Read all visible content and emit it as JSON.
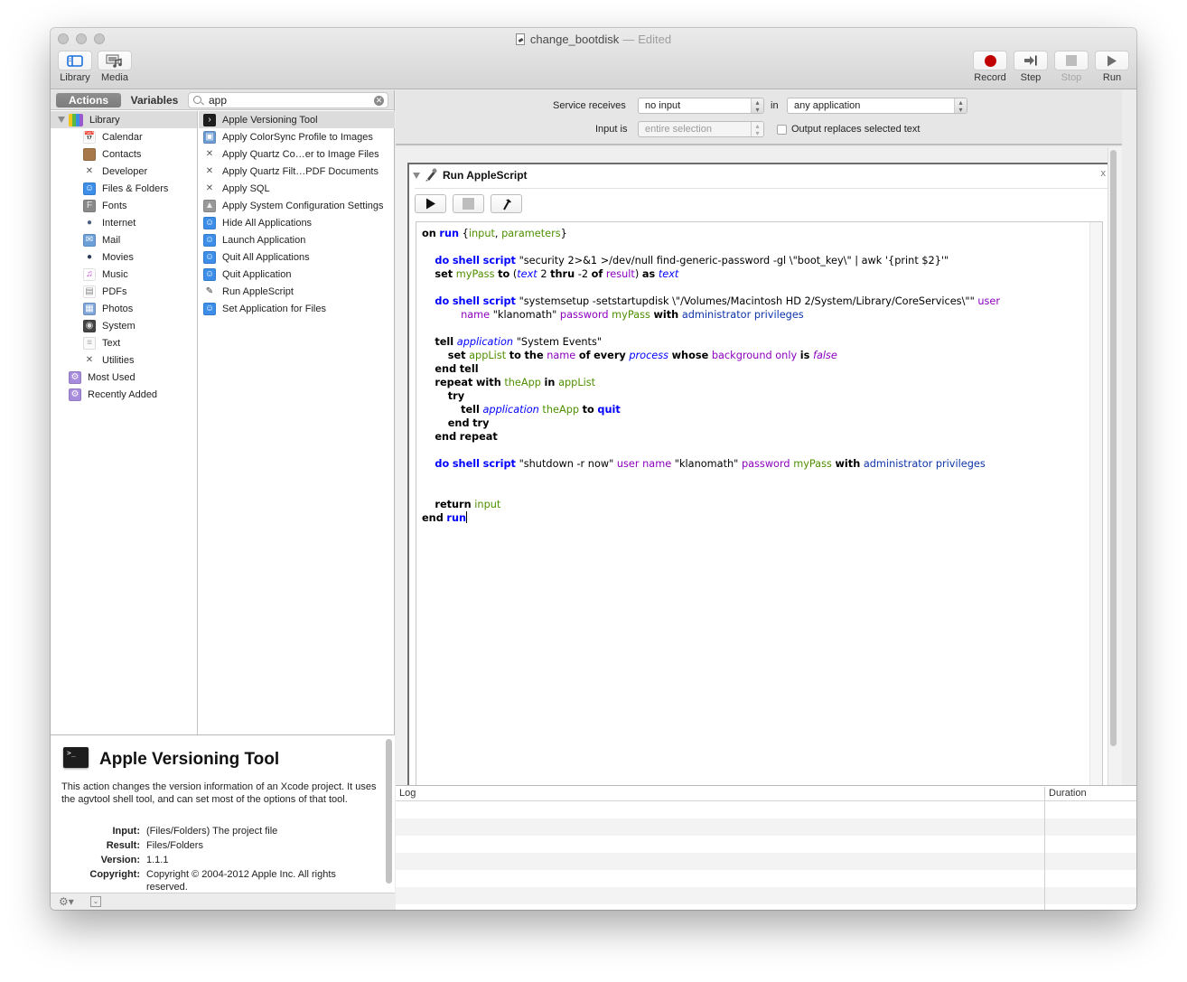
{
  "window": {
    "title": "change_bootdisk",
    "title_separator": "—",
    "status": "Edited"
  },
  "toolbar": {
    "left_buttons": [
      {
        "label": "Library",
        "icon": "library-sidebar-icon"
      },
      {
        "label": "Media",
        "icon": "media-icon"
      }
    ],
    "right_buttons": [
      {
        "label": "Record",
        "icon": "record-icon",
        "color": "#c00000",
        "enabled": true
      },
      {
        "label": "Step",
        "icon": "step-icon",
        "enabled": true
      },
      {
        "label": "Stop",
        "icon": "stop-icon",
        "enabled": false
      },
      {
        "label": "Run",
        "icon": "run-icon",
        "enabled": true
      }
    ]
  },
  "library_panel": {
    "tabs": {
      "actions": "Actions",
      "variables": "Variables"
    },
    "search": {
      "value": "app",
      "placeholder": ""
    },
    "library_root": "Library",
    "categories": [
      {
        "label": "Calendar",
        "icon": "calendar-icon"
      },
      {
        "label": "Contacts",
        "icon": "contacts-icon"
      },
      {
        "label": "Developer",
        "icon": "developer-tools-icon"
      },
      {
        "label": "Files & Folders",
        "icon": "finder-icon"
      },
      {
        "label": "Fonts",
        "icon": "fonts-icon"
      },
      {
        "label": "Internet",
        "icon": "globe-icon"
      },
      {
        "label": "Mail",
        "icon": "mail-icon"
      },
      {
        "label": "Movies",
        "icon": "quicktime-icon"
      },
      {
        "label": "Music",
        "icon": "music-icon"
      },
      {
        "label": "PDFs",
        "icon": "pdf-icon"
      },
      {
        "label": "Photos",
        "icon": "photos-icon"
      },
      {
        "label": "System",
        "icon": "system-icon"
      },
      {
        "label": "Text",
        "icon": "text-icon"
      },
      {
        "label": "Utilities",
        "icon": "utilities-icon"
      }
    ],
    "smart_groups": [
      {
        "label": "Most Used",
        "icon": "smart-folder-icon"
      },
      {
        "label": "Recently Added",
        "icon": "smart-folder-icon"
      }
    ],
    "actions": [
      {
        "label": "Apple Versioning Tool",
        "icon": "terminal-icon",
        "selected": true
      },
      {
        "label": "Apply ColorSync Profile to Images",
        "icon": "colorsync-icon"
      },
      {
        "label": "Apply Quartz Co…er to Image Files",
        "icon": "developer-tools-icon"
      },
      {
        "label": "Apply Quartz Filt…PDF Documents",
        "icon": "developer-tools-icon"
      },
      {
        "label": "Apply SQL",
        "icon": "developer-tools-icon"
      },
      {
        "label": "Apply System Configuration Settings",
        "icon": "system-config-icon"
      },
      {
        "label": "Hide All Applications",
        "icon": "finder-icon"
      },
      {
        "label": "Launch Application",
        "icon": "finder-icon"
      },
      {
        "label": "Quit All Applications",
        "icon": "finder-icon"
      },
      {
        "label": "Quit Application",
        "icon": "finder-icon"
      },
      {
        "label": "Run AppleScript",
        "icon": "script-editor-icon"
      },
      {
        "label": "Set Application for Files",
        "icon": "finder-icon"
      }
    ],
    "description": {
      "title": "Apple Versioning Tool",
      "body": "This action changes the version information of an Xcode project. It uses the agvtool shell tool, and can set most of the options of that tool.",
      "fields": [
        {
          "key": "Input:",
          "value": "(Files/Folders) The project file"
        },
        {
          "key": "Result:",
          "value": "Files/Folders"
        },
        {
          "key": "Version:",
          "value": "1.1.1"
        },
        {
          "key": "Copyright:",
          "value": "Copyright © 2004-2012 Apple Inc.  All rights reserved."
        }
      ]
    }
  },
  "service_bar": {
    "receives_label": "Service receives",
    "receives_value": "no input",
    "in_label": "in",
    "in_value": "any application",
    "input_is_label": "Input is",
    "input_is_value": "entire selection",
    "output_replaces_label": "Output replaces selected text",
    "output_replaces_checked": false
  },
  "action_card": {
    "title": "Run AppleScript",
    "close": "x",
    "editor_buttons": [
      "run-script",
      "stop-script",
      "compile-script"
    ],
    "script_lines": [
      "on run {input, parameters}",
      "",
      "do shell script \"security 2>&1 >/dev/null find-generic-password -gl \\\"boot_key\\\" | awk '{print $2}'\"",
      "set myPass to (text 2 thru -2 of result) as text",
      "",
      "do shell script \"systemsetup -setstartupdisk \\\"/Volumes/Macintosh HD 2/System/Library/CoreServices\\\"\" user name \"klanomath\" password myPass with administrator privileges",
      "",
      "tell application \"System Events\"",
      "set appList to the name of every process whose background only is false",
      "end tell",
      "repeat with theApp in appList",
      "try",
      "tell application theApp to quit",
      "end try",
      "end repeat",
      "",
      "do shell script \"shutdown -r now\" user name \"klanomath\" password myPass with administrator privileges",
      "",
      "",
      "return input",
      "end run"
    ]
  },
  "log": {
    "columns": [
      "Log",
      "Duration"
    ],
    "rows": []
  }
}
